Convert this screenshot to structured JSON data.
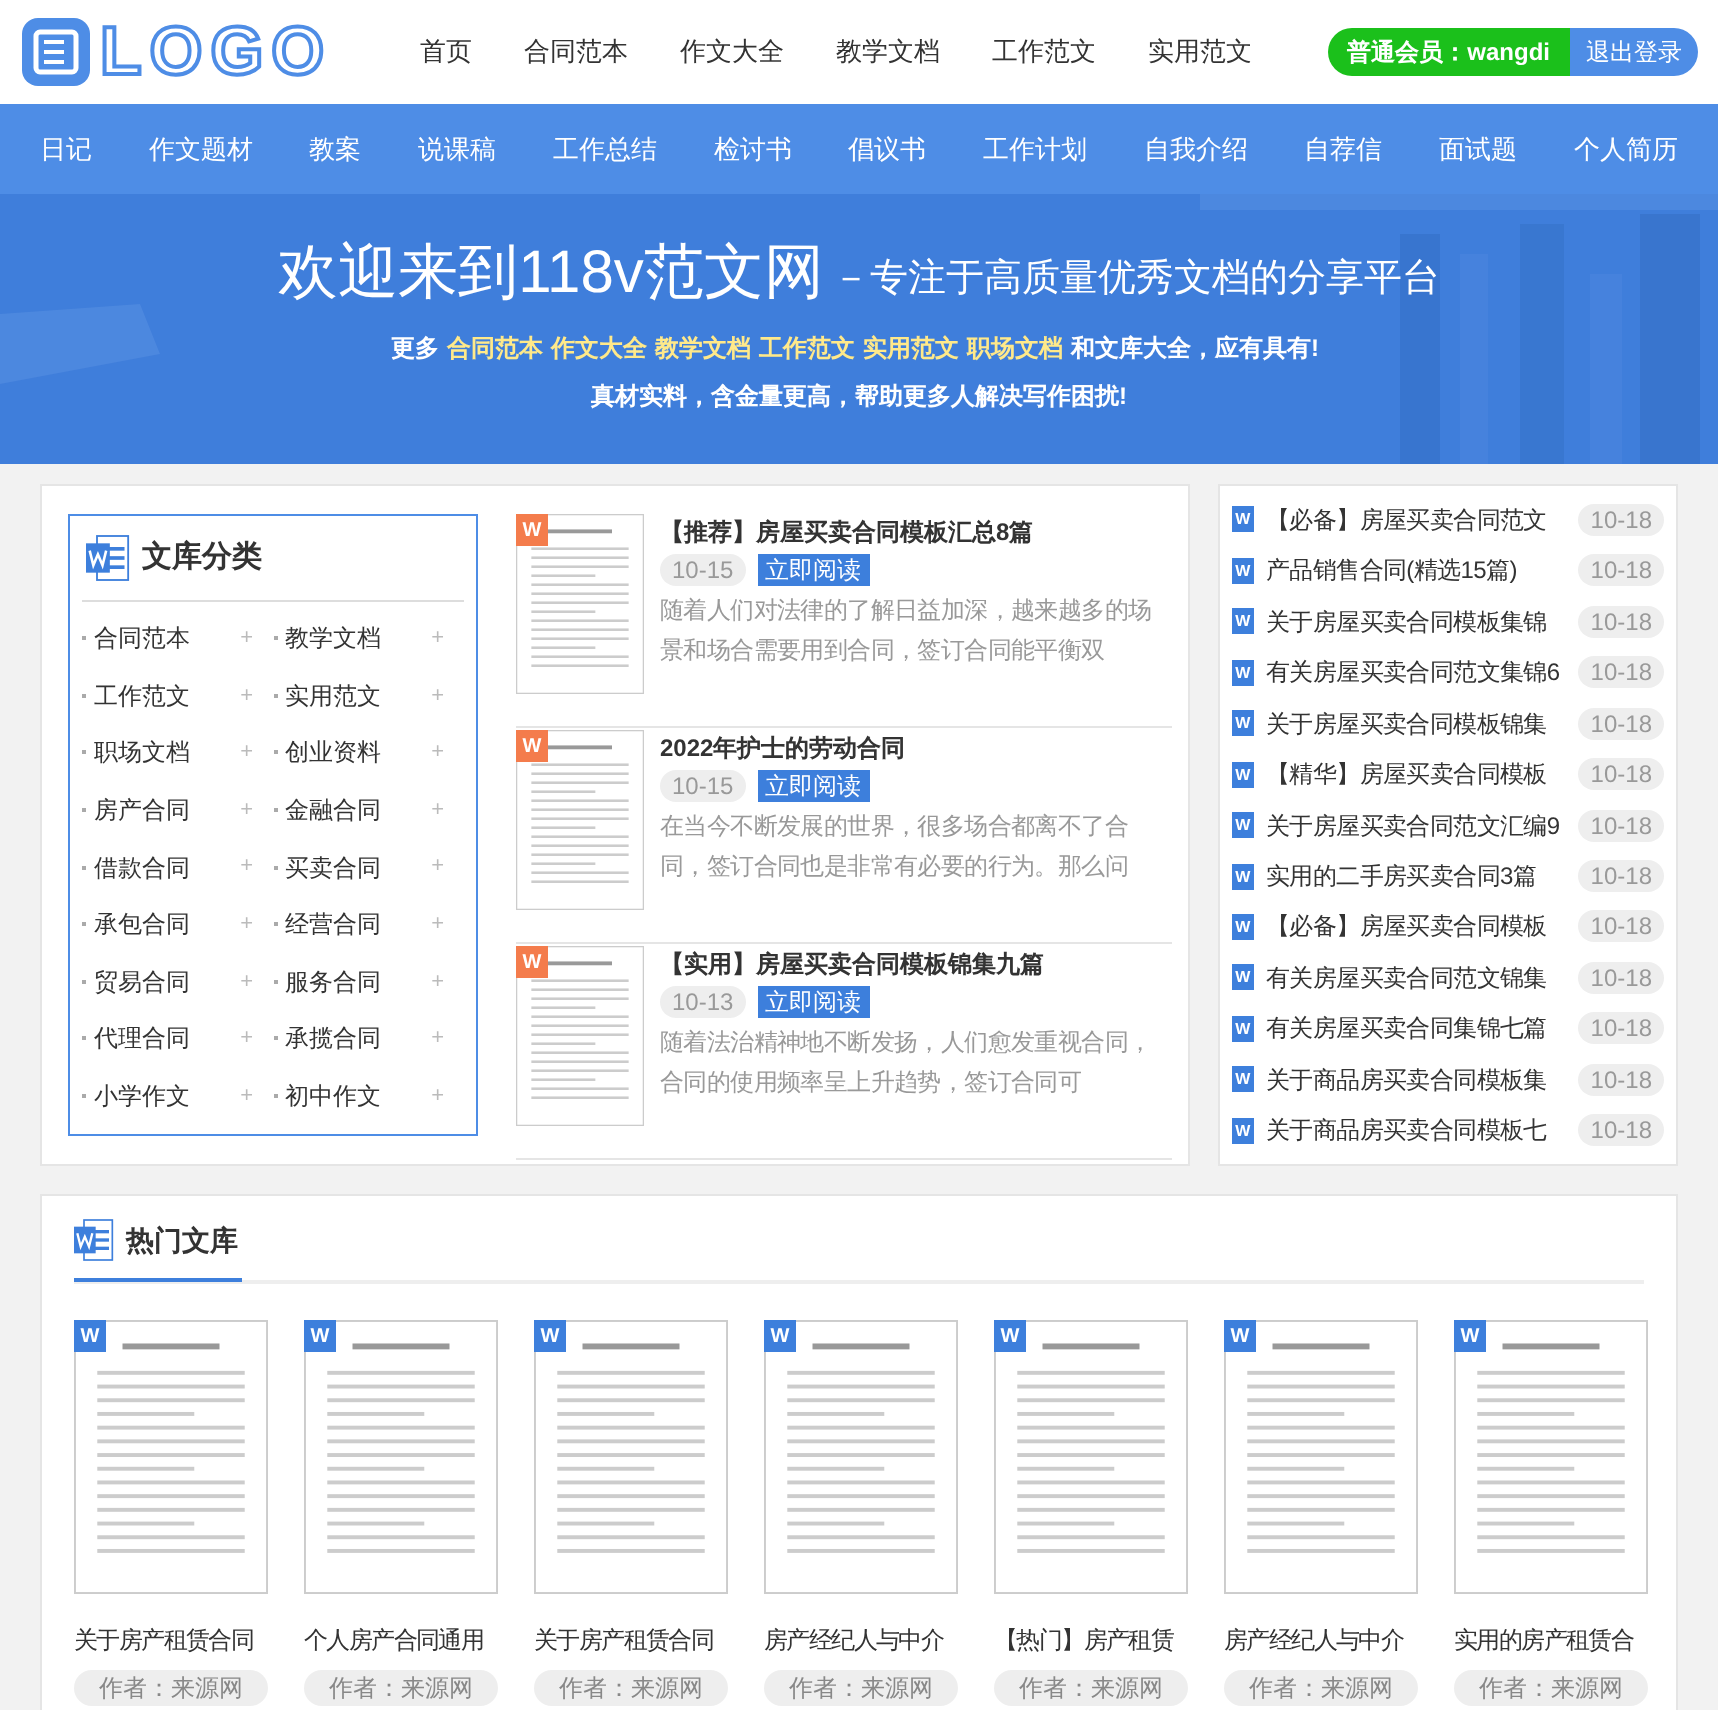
{
  "header": {
    "logo": "LOGO",
    "nav": [
      {
        "label": "首页",
        "selected": false
      },
      {
        "label": "合同范本",
        "selected": false
      },
      {
        "label": "作文大全",
        "selected": false
      },
      {
        "label": "教学文档",
        "selected": false
      },
      {
        "label": "工作范文",
        "selected": false
      },
      {
        "label": "实用范文",
        "selected": false
      }
    ],
    "member": "普通会员：wangdi",
    "logout": "退出登录"
  },
  "category_nav": [
    "日记",
    "作文题材",
    "教案",
    "说课稿",
    "工作总结",
    "检讨书",
    "倡议书",
    "工作计划",
    "自我介绍",
    "自荐信",
    "面试题",
    "个人简历"
  ],
  "hero": {
    "title": "欢迎来到118v范文网",
    "subtitle": "－专注于高质量优秀文档的分享平台",
    "line1": [
      {
        "text": "更多",
        "highlight": false
      },
      {
        "text": "合同范本",
        "highlight": true
      },
      {
        "text": "作文大全",
        "highlight": true
      },
      {
        "text": "教学文档",
        "highlight": true
      },
      {
        "text": "工作范文",
        "highlight": true
      },
      {
        "text": "实用范文",
        "highlight": true
      },
      {
        "text": "职场文档",
        "highlight": true
      },
      {
        "text": "和文库大全，应有具有!",
        "highlight": false
      }
    ],
    "line2": "真材实料，含金量更高，帮助更多人解决写作困扰!"
  },
  "categories": {
    "title": "文库分类",
    "items": [
      "合同范本",
      "教学文档",
      "工作范文",
      "实用范文",
      "职场文档",
      "创业资料",
      "房产合同",
      "金融合同",
      "借款合同",
      "买卖合同",
      "承包合同",
      "经营合同",
      "贸易合同",
      "服务合同",
      "代理合同",
      "承揽合同",
      "小学作文",
      "初中作文"
    ],
    "plus": "+"
  },
  "featured": [
    {
      "badge": "W",
      "title": "【推荐】房屋买卖合同模板汇总8篇",
      "date": "10-15",
      "button": "立即阅读",
      "excerpt": "随着人们对法律的了解日益加深，越来越多的场景和场合需要用到合同，签订合同能平衡双"
    },
    {
      "badge": "W",
      "title": "2022年护士的劳动合同",
      "date": "10-15",
      "button": "立即阅读",
      "excerpt": "在当今不断发展的世界，很多场合都离不了合同，签订合同也是非常有必要的行为。那么问"
    },
    {
      "badge": "W",
      "title": "【实用】房屋买卖合同模板锦集九篇",
      "date": "10-13",
      "button": "立即阅读",
      "excerpt": "随着法治精神地不断发扬，人们愈发重视合同，合同的使用频率呈上升趋势，签订合同可"
    }
  ],
  "latest": [
    {
      "badge": "W",
      "title": "【必备】房屋买卖合同范文",
      "date": "10-18"
    },
    {
      "badge": "W",
      "title": "产品销售合同(精选15篇)",
      "date": "10-18"
    },
    {
      "badge": "W",
      "title": "关于房屋买卖合同模板集锦",
      "date": "10-18"
    },
    {
      "badge": "W",
      "title": "有关房屋买卖合同范文集锦6",
      "date": "10-18"
    },
    {
      "badge": "W",
      "title": "关于房屋买卖合同模板锦集",
      "date": "10-18"
    },
    {
      "badge": "W",
      "title": "【精华】房屋买卖合同模板",
      "date": "10-18"
    },
    {
      "badge": "W",
      "title": "关于房屋买卖合同范文汇编9",
      "date": "10-18"
    },
    {
      "badge": "W",
      "title": "实用的二手房买卖合同3篇",
      "date": "10-18"
    },
    {
      "badge": "W",
      "title": "【必备】房屋买卖合同模板",
      "date": "10-18"
    },
    {
      "badge": "W",
      "title": "有关房屋买卖合同范文锦集",
      "date": "10-18"
    },
    {
      "badge": "W",
      "title": "有关房屋买卖合同集锦七篇",
      "date": "10-18"
    },
    {
      "badge": "W",
      "title": "关于商品房买卖合同模板集",
      "date": "10-18"
    },
    {
      "badge": "W",
      "title": "关于商品房买卖合同模板七",
      "date": "10-18"
    }
  ],
  "hot": {
    "title": "热门文库",
    "items": [
      {
        "badge": "W",
        "title": "关于房产租赁合同",
        "author": "作者：来源网"
      },
      {
        "badge": "W",
        "title": "个人房产合同通用",
        "author": "作者：来源网"
      },
      {
        "badge": "W",
        "title": "关于房产租赁合同",
        "author": "作者：来源网"
      },
      {
        "badge": "W",
        "title": "房产经纪人与中介",
        "author": "作者：来源网"
      },
      {
        "badge": "W",
        "title": "【热门】房产租赁",
        "author": "作者：来源网"
      },
      {
        "badge": "W",
        "title": "房产经纪人与中介",
        "author": "作者：来源网"
      },
      {
        "badge": "W",
        "title": "实用的房产租赁合",
        "author": "作者：来源网"
      }
    ]
  }
}
